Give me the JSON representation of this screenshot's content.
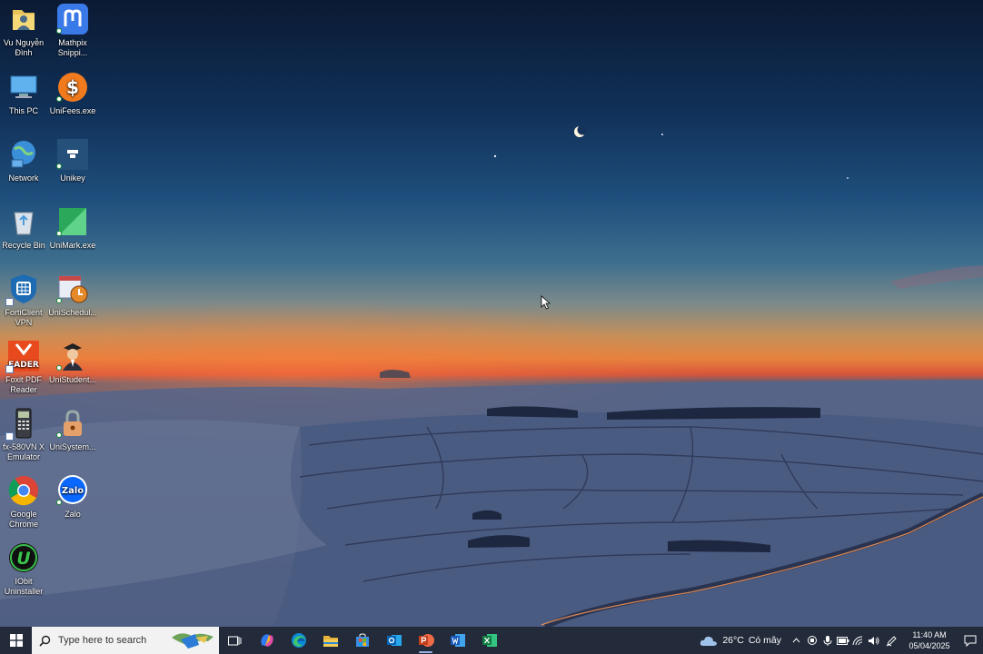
{
  "desktop": {
    "icons": [
      {
        "name": "user-folder-icon",
        "label": "Vu Nguyễn Đình"
      },
      {
        "name": "mathpix-icon",
        "label": "Mathpix Snippi..."
      },
      {
        "name": "this-pc-icon",
        "label": "This PC"
      },
      {
        "name": "unifees-icon",
        "label": "UniFees.exe"
      },
      {
        "name": "network-icon",
        "label": "Network"
      },
      {
        "name": "unikey-icon",
        "label": "Unikey"
      },
      {
        "name": "recycle-bin-icon",
        "label": "Recycle Bin"
      },
      {
        "name": "unimark-icon",
        "label": "UniMark.exe"
      },
      {
        "name": "forticlient-icon",
        "label": "FortiClient VPN"
      },
      {
        "name": "unischedule-icon",
        "label": "UniSchedul..."
      },
      {
        "name": "foxit-reader-icon",
        "label": "Foxit PDF Reader"
      },
      {
        "name": "unistudent-icon",
        "label": "UniStudent..."
      },
      {
        "name": "calculator-emulator-icon",
        "label": "fx-580VN X Emulator"
      },
      {
        "name": "unisystem-icon",
        "label": "UniSystem..."
      },
      {
        "name": "google-chrome-icon",
        "label": "Google Chrome"
      },
      {
        "name": "zalo-icon",
        "label": "Zalo"
      },
      {
        "name": "iobit-uninstaller-icon",
        "label": "IObit Uninstaller"
      }
    ],
    "glyph_text": {
      "foxit": "EADER",
      "zalo": "Zalo",
      "unifees": "$",
      "iobit": "U"
    }
  },
  "taskbar": {
    "search_placeholder": "Type here to search",
    "apps": [
      {
        "name": "task-view-icon"
      },
      {
        "name": "copilot-icon"
      },
      {
        "name": "edge-icon"
      },
      {
        "name": "file-explorer-icon"
      },
      {
        "name": "microsoft-store-icon"
      },
      {
        "name": "outlook-icon"
      },
      {
        "name": "powerpoint-icon"
      },
      {
        "name": "word-icon"
      },
      {
        "name": "excel-icon"
      }
    ],
    "weather": {
      "temp": "26°C",
      "condition": "Có mây"
    },
    "clock": {
      "time": "11:40 AM",
      "date": "05/04/2025"
    },
    "colors": {
      "taskbar": "#232b3a",
      "accent": "#9ab4e4"
    }
  }
}
